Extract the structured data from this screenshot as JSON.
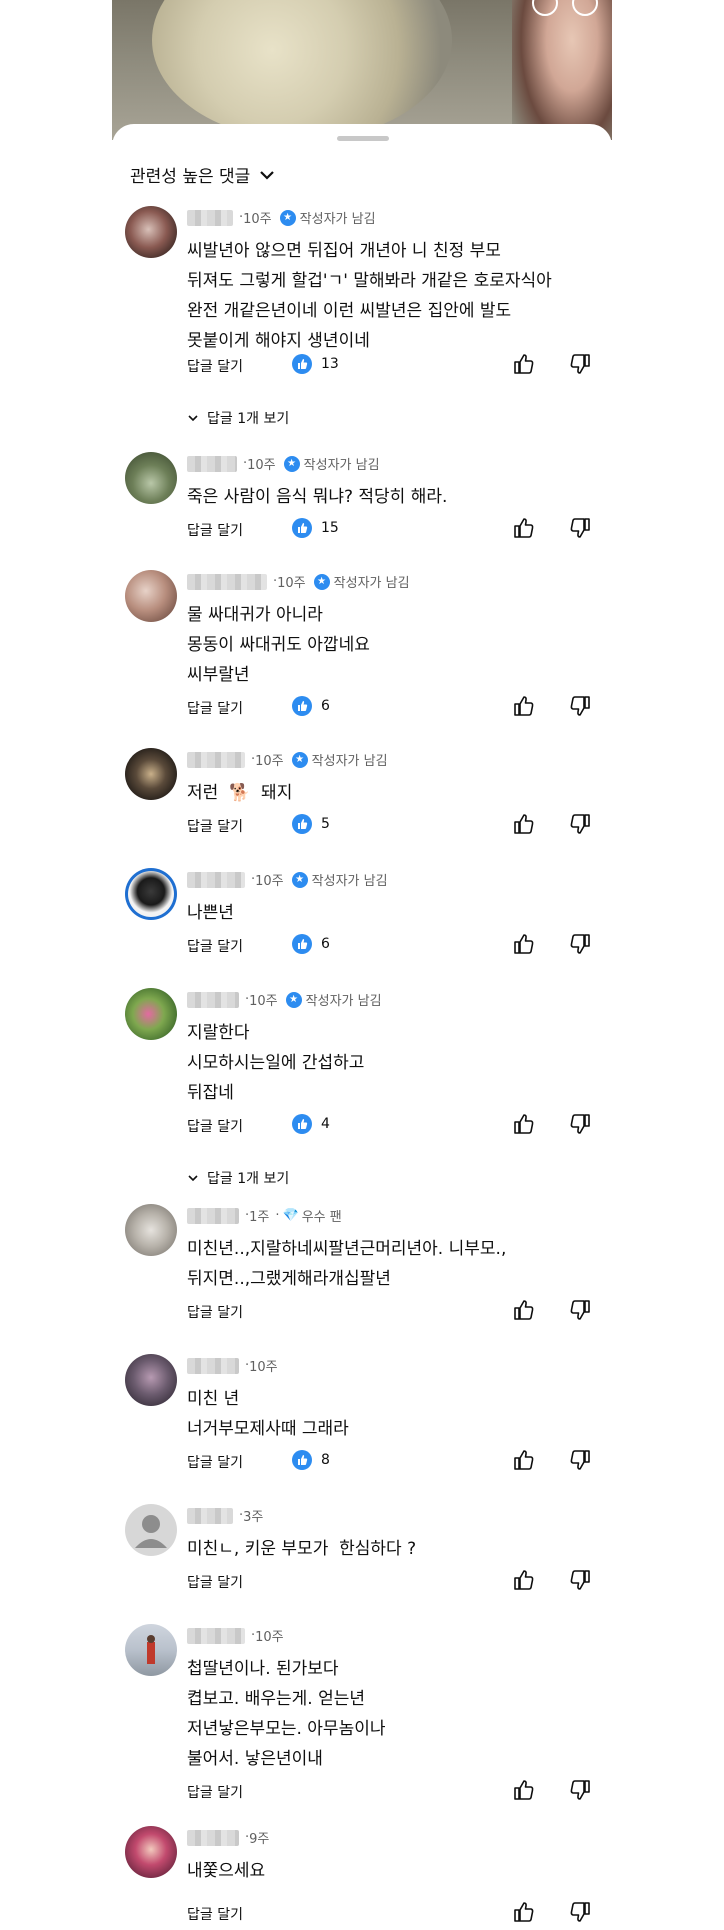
{
  "sort": {
    "label": "관련성 높은 댓글"
  },
  "labels": {
    "reply": "답글 달기",
    "creator_badge": "작성자가 남김"
  },
  "comments": [
    {
      "age": "10주",
      "creator": true,
      "lines": "씨발년아 않으면 뒤집어 개년아 니 친정 부모\n뒤져도 그렇게 할겁'ㄱ' 말해봐라 개같은 호로자식아\n완전 개같은년이네 이런 씨발년은 집안에 발도\n못붙이게 해야지 생년이네",
      "likes": "13",
      "replies": "답글 1개 보기"
    },
    {
      "age": "10주",
      "creator": true,
      "lines": "죽은 사람이 음식 뭐냐? 적당히 해라.",
      "likes": "15"
    },
    {
      "age": "10주",
      "creator": true,
      "lines": "물 싸대귀가 아니라\n몽동이 싸대귀도 아깝네요\n씨부랄년",
      "likes": "6"
    },
    {
      "age": "10주",
      "creator": true,
      "lines": "저런  🐕  돼지",
      "likes": "5"
    },
    {
      "age": "10주",
      "creator": true,
      "lines": "나쁜년",
      "likes": "6"
    },
    {
      "age": "10주",
      "creator": true,
      "lines": "지랄한다\n시모하시는일에 간섭하고\n뒤잡네",
      "likes": "4",
      "replies": "답글 1개 보기"
    },
    {
      "age": "1주",
      "fan": "우수 팬",
      "lines": "미친년..,지랄하네씨팔년근머리년아. 니부모.,\n뒤지면..,그랬게해라개십팔년",
      "likes": ""
    },
    {
      "age": "10주",
      "lines": "미친 년\n너거부모제사때 그래라",
      "likes": "8"
    },
    {
      "age": "3주",
      "lines": "미친ㄴ, 키운 부모가  한심하다 ?",
      "likes": ""
    },
    {
      "age": "10주",
      "lines": "첩딸년이나. 된가보다\n켭보고. 배우는게. 얻는년\n저년낳은부모는. 아무놈이나\n불어서. 낳은년이내",
      "likes": ""
    },
    {
      "age": "9주",
      "lines": "내쫓으세요",
      "likes": ""
    }
  ]
}
